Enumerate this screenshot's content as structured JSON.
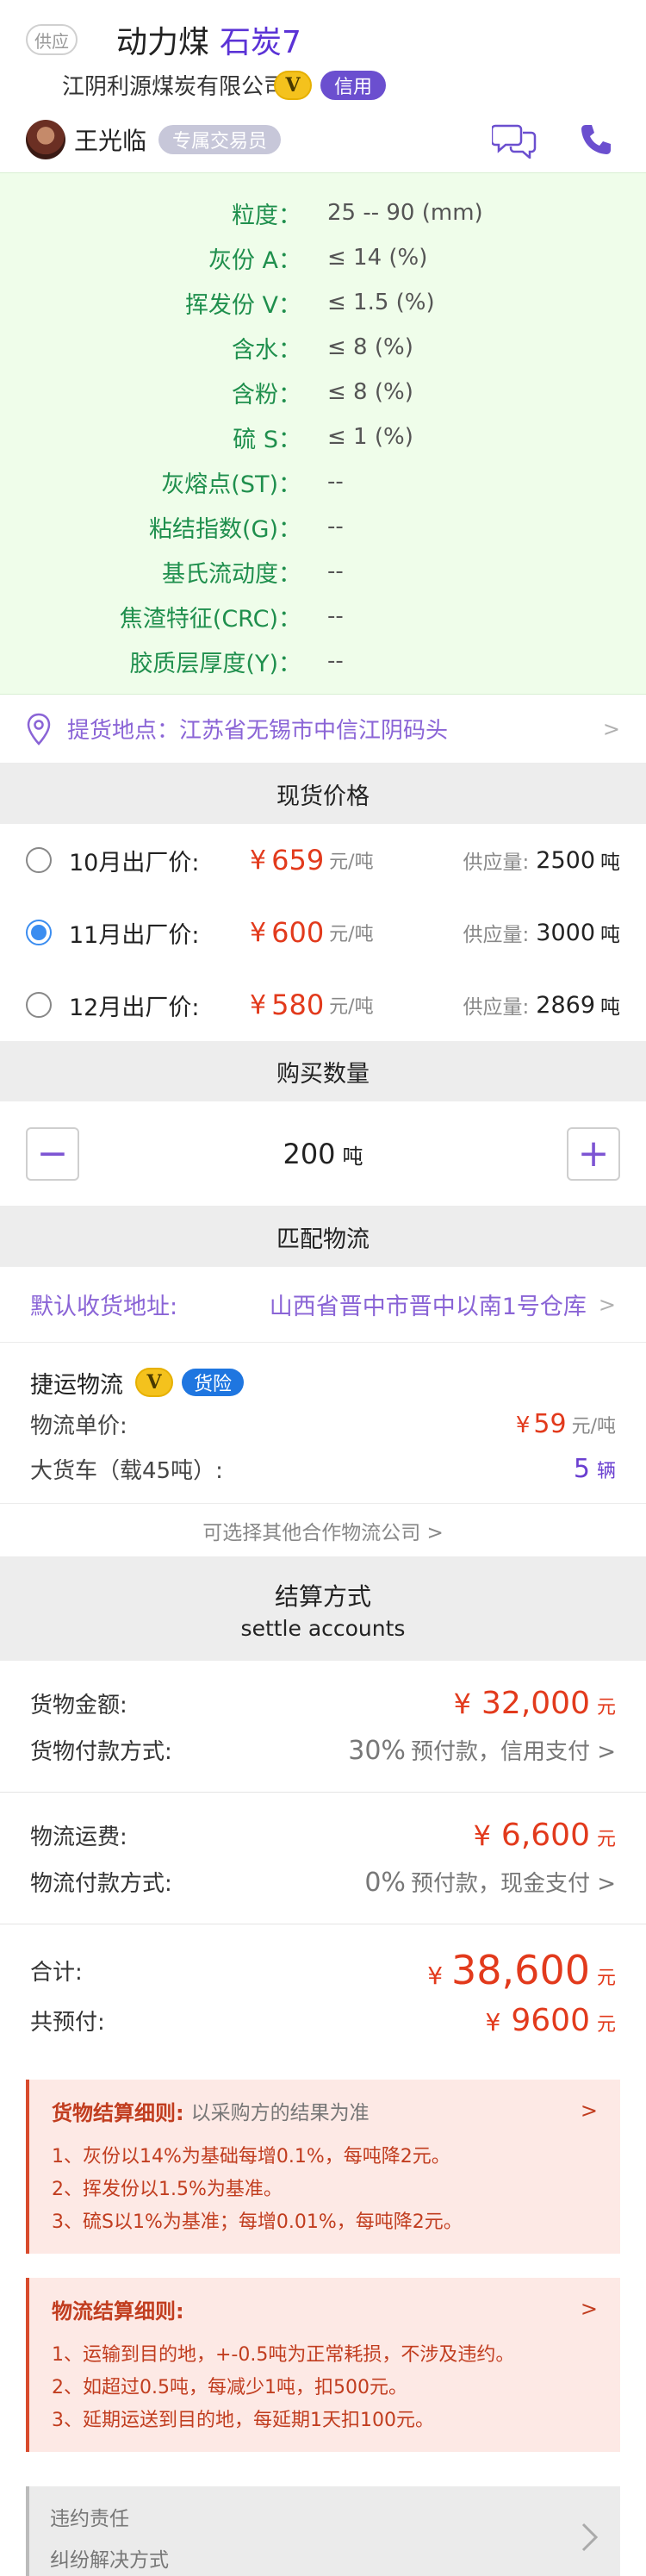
{
  "header": {
    "supply_tag": "供应",
    "product_name": "动力煤",
    "product_type": "石炭7",
    "company": "江阴利源煤炭有限公司",
    "v_badge": "V",
    "credit_badge": "信用",
    "agent_name": "王光临",
    "agent_tag": "专属交易员"
  },
  "specs": [
    {
      "label": "粒度：",
      "value": "25 -- 90 (mm)"
    },
    {
      "label": "灰份 A：",
      "value": "≤ 14 (%)"
    },
    {
      "label": "挥发份 V：",
      "value": "≤ 1.5 (%)"
    },
    {
      "label": "含水：",
      "value": "≤ 8 (%)"
    },
    {
      "label": "含粉：",
      "value": "≤ 8 (%)"
    },
    {
      "label": "硫 S：",
      "value": "≤ 1 (%)"
    },
    {
      "label": "灰熔点(ST)：",
      "value": "--"
    },
    {
      "label": "粘结指数(G)：",
      "value": "--"
    },
    {
      "label": "基氏流动度：",
      "value": "--"
    },
    {
      "label": "焦渣特征(CRC)：",
      "value": "--"
    },
    {
      "label": "胶质层厚度(Y)：",
      "value": "--"
    }
  ],
  "pickup": {
    "text": "提货地点：江苏省无锡市中信江阴码头",
    "chevron": ">"
  },
  "spot_price": {
    "title": "现货价格",
    "options": [
      {
        "label": "10月出厂价:",
        "yen": "¥",
        "price": "659",
        "unit": "元/吨",
        "supply_label": "供应量:",
        "supply": "2500",
        "supply_unit": "吨",
        "selected": false
      },
      {
        "label": "11月出厂价:",
        "yen": "¥",
        "price": "600",
        "unit": "元/吨",
        "supply_label": "供应量:",
        "supply": "3000",
        "supply_unit": "吨",
        "selected": true
      },
      {
        "label": "12月出厂价:",
        "yen": "¥",
        "price": "580",
        "unit": "元/吨",
        "supply_label": "供应量:",
        "supply": "2869",
        "supply_unit": "吨",
        "selected": false
      }
    ]
  },
  "quantity": {
    "title": "购买数量",
    "minus": "−",
    "plus": "+",
    "value": "200",
    "unit": "吨"
  },
  "logistics": {
    "title": "匹配物流",
    "address_label": "默认收货地址:",
    "address_value": "山西省晋中市晋中以南1号仓库",
    "chevron": ">",
    "carrier_name": "捷运物流",
    "v_badge": "V",
    "insurance_badge": "货险",
    "unit_price_label": "物流单价:",
    "unit_price_yen": "¥",
    "unit_price": "59",
    "unit_price_unit": "元/吨",
    "truck_label": "大货车（载45吨）:",
    "truck_count": "5",
    "truck_unit": "辆",
    "more_link": "可选择其他合作物流公司 >"
  },
  "settlement": {
    "title": "结算方式",
    "subtitle": "settle accounts",
    "goods_amount_label": "货物金额:",
    "goods_amount_yen": "¥",
    "goods_amount": "32,000",
    "goods_amount_unit": "元",
    "goods_method_label": "货物付款方式:",
    "goods_method_pct": "30%",
    "goods_method_text": "预付款，信用支付 >",
    "freight_label": "物流运费:",
    "freight_yen": "¥",
    "freight": "6,600",
    "freight_unit": "元",
    "freight_method_label": "物流付款方式:",
    "freight_method_pct": "0%",
    "freight_method_text": "预付款，现金支付 >",
    "total_label": "合计:",
    "total_yen": "¥",
    "total": "38,600",
    "total_unit": "元",
    "prepay_label": "共预付:",
    "prepay_yen": "¥",
    "prepay": "9600",
    "prepay_unit": "元"
  },
  "goods_rules": {
    "title": "货物结算细则:",
    "note": "以采购方的结果为准",
    "chevron": ">",
    "lines": [
      "1、灰份以14%为基础每增0.1%，每吨降2元。",
      "2、挥发份以1.5%为基准。",
      "3、硫S以1%为基准；每增0.01%，每吨降2元。"
    ]
  },
  "logistics_rules": {
    "title": "物流结算细则:",
    "chevron": ">",
    "lines": [
      "1、运输到目的地，+-0.5吨为正常耗损，不涉及违约。",
      "2、如超过0.5吨，每减少1吨，扣500元。",
      "3、延期运送到目的地，每延期1天扣100元。"
    ]
  },
  "breach": {
    "line1": "违约责任",
    "line2": "纠纷解决方式"
  },
  "colors": {
    "accent": "#6b4fcf",
    "price_red": "#e23a1c",
    "spec_green": "#1f8f4d",
    "spec_bg": "#effdea",
    "rule_bg": "#fde9e5"
  }
}
